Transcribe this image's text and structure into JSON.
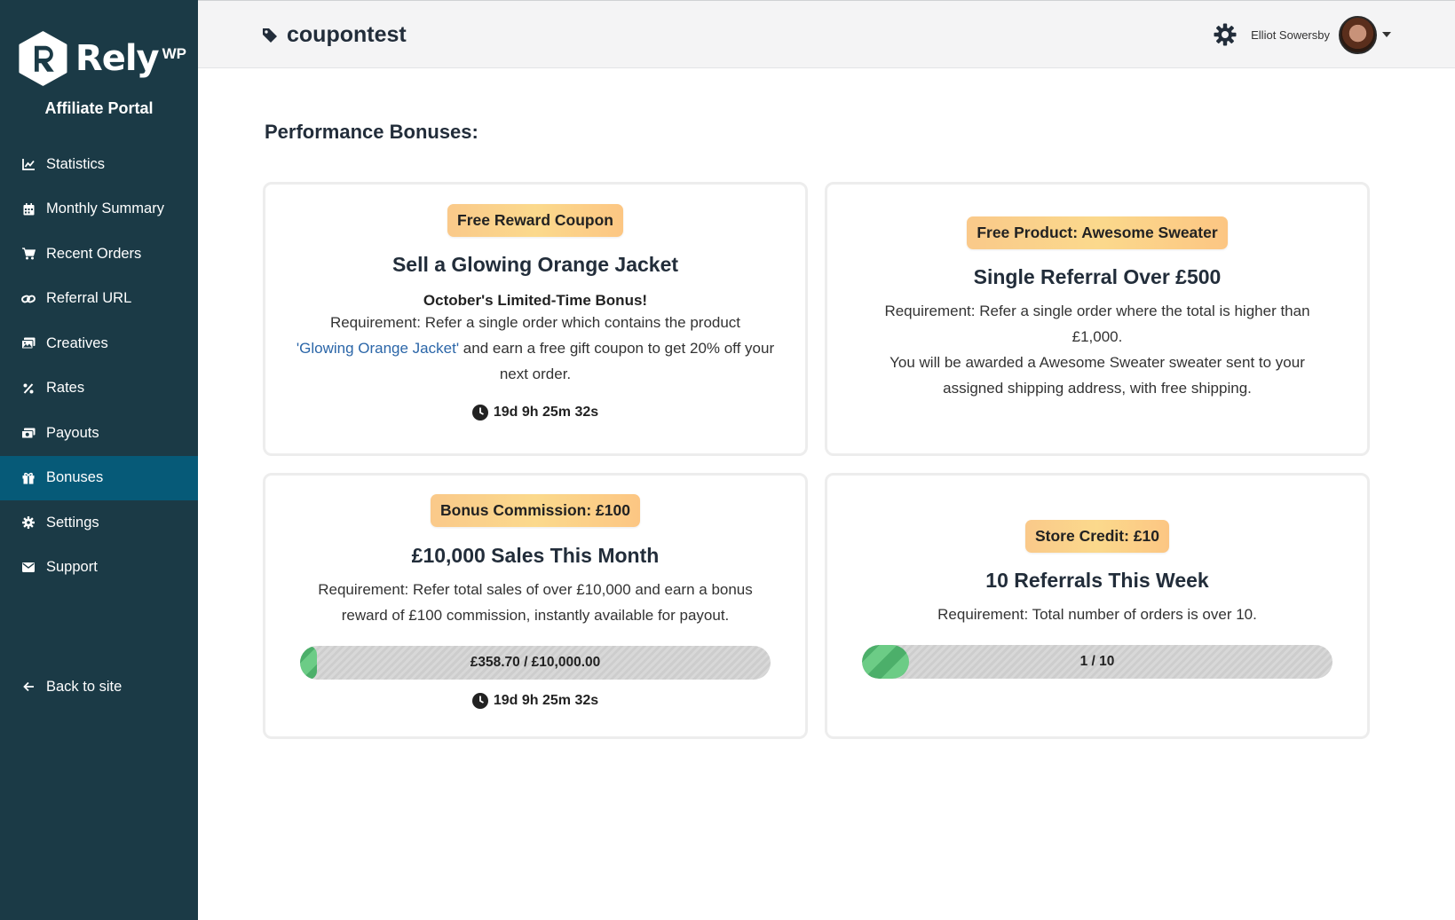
{
  "brand": {
    "logo_text": "Rely",
    "logo_suffix": "WP",
    "portal_title": "Affiliate Portal"
  },
  "sidebar": {
    "items": [
      {
        "label": "Statistics",
        "icon": "chart-line-icon"
      },
      {
        "label": "Monthly Summary",
        "icon": "calendar-icon"
      },
      {
        "label": "Recent Orders",
        "icon": "cart-icon"
      },
      {
        "label": "Referral URL",
        "icon": "link-icon"
      },
      {
        "label": "Creatives",
        "icon": "images-icon"
      },
      {
        "label": "Rates",
        "icon": "percent-icon"
      },
      {
        "label": "Payouts",
        "icon": "money-icon"
      },
      {
        "label": "Bonuses",
        "icon": "gift-icon",
        "active": true
      },
      {
        "label": "Settings",
        "icon": "gear-icon"
      },
      {
        "label": "Support",
        "icon": "envelope-icon"
      }
    ],
    "back_label": "Back to site"
  },
  "header": {
    "store_name": "coupontest",
    "user_name": "Elliot Sowersby"
  },
  "main": {
    "section_title": "Performance Bonuses:",
    "cards": [
      {
        "badge": "Free Reward Coupon",
        "title": "Sell a Glowing Orange Jacket",
        "subtitle": "October's Limited-Time Bonus!",
        "text_before": "Requirement: Refer a single order which contains the product",
        "link": "'Glowing Orange Jacket'",
        "text_after": " and earn a free gift coupon to get 20% off your next order.",
        "timer": "19d 9h 25m 32s"
      },
      {
        "badge": "Free Product: Awesome Sweater",
        "title": "Single Referral Over £500",
        "line1": "Requirement: Refer a single order where the total is higher than £1,000.",
        "line2": "You will be awarded a Awesome Sweater sweater sent to your assigned shipping address, with free shipping."
      },
      {
        "badge": "Bonus Commission: £100",
        "title": "£10,000 Sales This Month",
        "text": "Requirement: Refer total sales of over £10,000 and earn a bonus reward of £100 commission, instantly available for payout.",
        "progress_label": "£358.70 / £10,000.00",
        "progress_value": 358.7,
        "progress_max": 10000.0,
        "timer": "19d 9h 25m 32s"
      },
      {
        "badge": "Store Credit: £10",
        "title": "10 Referrals This Week",
        "text": "Requirement: Total number of orders is over 10.",
        "progress_label": "1 / 10",
        "progress_value": 1,
        "progress_max": 10
      }
    ]
  }
}
